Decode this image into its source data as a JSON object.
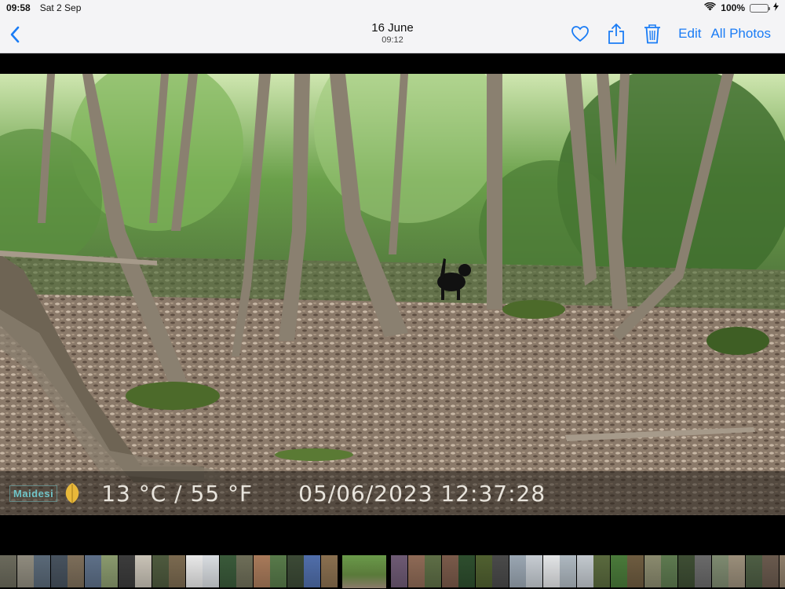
{
  "status": {
    "time": "09:58",
    "date": "Sat 2 Sep",
    "battery": "100%",
    "battery_level": 1.0,
    "icons": [
      "wifi-icon",
      "battery-icon",
      "charging-icon"
    ]
  },
  "nav": {
    "back_icon": "chevron-left-icon",
    "title": "16 June",
    "subtitle": "09:12",
    "icons": [
      "heart-icon",
      "share-icon",
      "trash-icon"
    ],
    "edit_label": "Edit",
    "all_photos_label": "All Photos",
    "accent_color": "#1a7cf5"
  },
  "photo": {
    "brand": "Maidesi",
    "temperature": "13 °C / 55 °F",
    "timestamp": "05/06/2023 12:37:28"
  },
  "thumbnails": {
    "colors": [
      "#6b6a5c",
      "#8f8b7e",
      "#5a6978",
      "#47525e",
      "#7d6e5a",
      "#5e7088",
      "#8a9a6e",
      "#3c3c3c",
      "#c8c2b6",
      "#4e5a3e",
      "#7b6a50",
      "#e8e8e8",
      "#d8dce0",
      "#3a5a3a",
      "#6e6e58",
      "#a87a5a",
      "#587a4a",
      "#3c4a36",
      "#506eaa",
      "#8a7050",
      "#4a6e3a",
      "#6e5a74",
      "#8e6a56",
      "#5e6e46",
      "#7a5a4a",
      "#2e4e2e",
      "#506030",
      "#4a4a4a",
      "#9aa6b2",
      "#c6ccd2",
      "#e2e4e6",
      "#aeb8c0",
      "#c2c8ce",
      "#5a6a3e",
      "#4a7a3a",
      "#6e5c40",
      "#8a8a6e",
      "#5e7a50",
      "#3e4e34",
      "#6a6a6a",
      "#7e8a70",
      "#9a8e7a",
      "#4e5e44",
      "#6a5a4e",
      "#8e7e6a",
      "#5a6e4e",
      "#7a8a6a",
      "#4e5040",
      "#a4988a",
      "#6e7a5e"
    ],
    "current_index": 20
  }
}
